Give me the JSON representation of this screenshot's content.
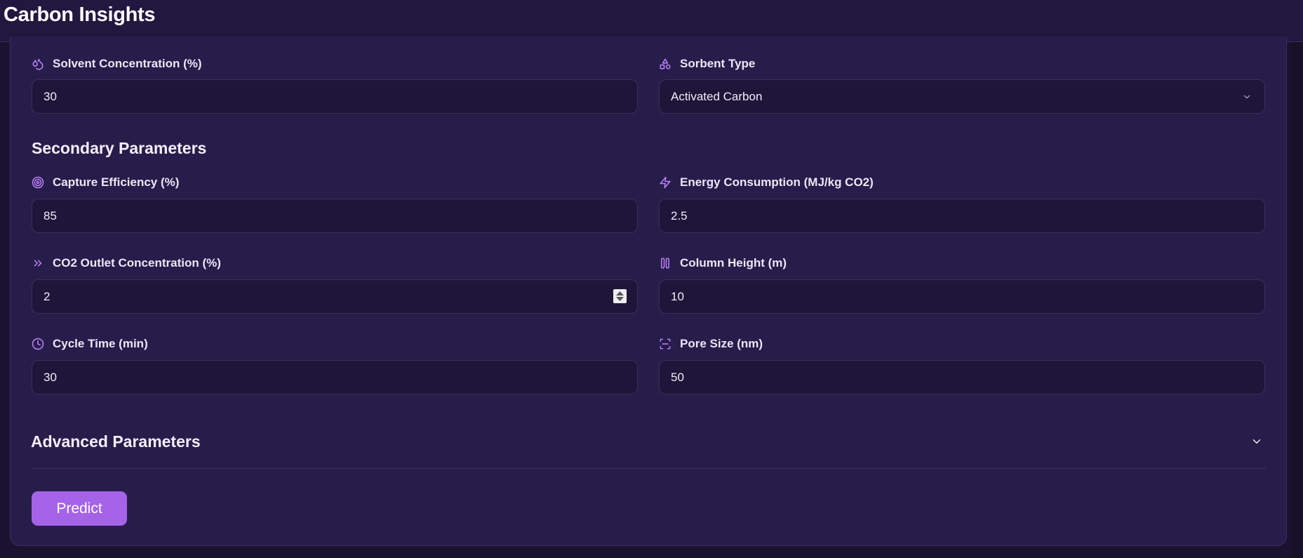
{
  "app": {
    "title": "Carbon Insights"
  },
  "fields": {
    "solvent_concentration": {
      "label": "Solvent Concentration (%)",
      "value": "30"
    },
    "sorbent_type": {
      "label": "Sorbent Type",
      "value": "Activated Carbon"
    },
    "capture_efficiency": {
      "label": "Capture Efficiency (%)",
      "value": "85"
    },
    "energy_consumption": {
      "label": "Energy Consumption (MJ/kg CO2)",
      "value": "2.5"
    },
    "co2_outlet_concentration": {
      "label": "CO2 Outlet Concentration (%)",
      "value": "2"
    },
    "column_height": {
      "label": "Column Height (m)",
      "value": "10"
    },
    "cycle_time": {
      "label": "Cycle Time (min)",
      "value": "30"
    },
    "pore_size": {
      "label": "Pore Size (nm)",
      "value": "50"
    }
  },
  "sections": {
    "secondary": "Secondary Parameters",
    "advanced": "Advanced Parameters"
  },
  "actions": {
    "predict_label": "Predict"
  },
  "icons": {
    "solvent_concentration": "droplets-icon",
    "sorbent_type": "shapes-icon",
    "capture_efficiency": "target-icon",
    "energy_consumption": "zap-icon",
    "co2_outlet_concentration": "chevrons-right-icon",
    "column_height": "columns-icon",
    "cycle_time": "clock-icon",
    "pore_size": "scan-icon"
  },
  "colors": {
    "accent": "#a563e8",
    "icon": "#c084fc",
    "background": "#1a1330",
    "card": "#271d4a",
    "input": "#1e1538"
  }
}
